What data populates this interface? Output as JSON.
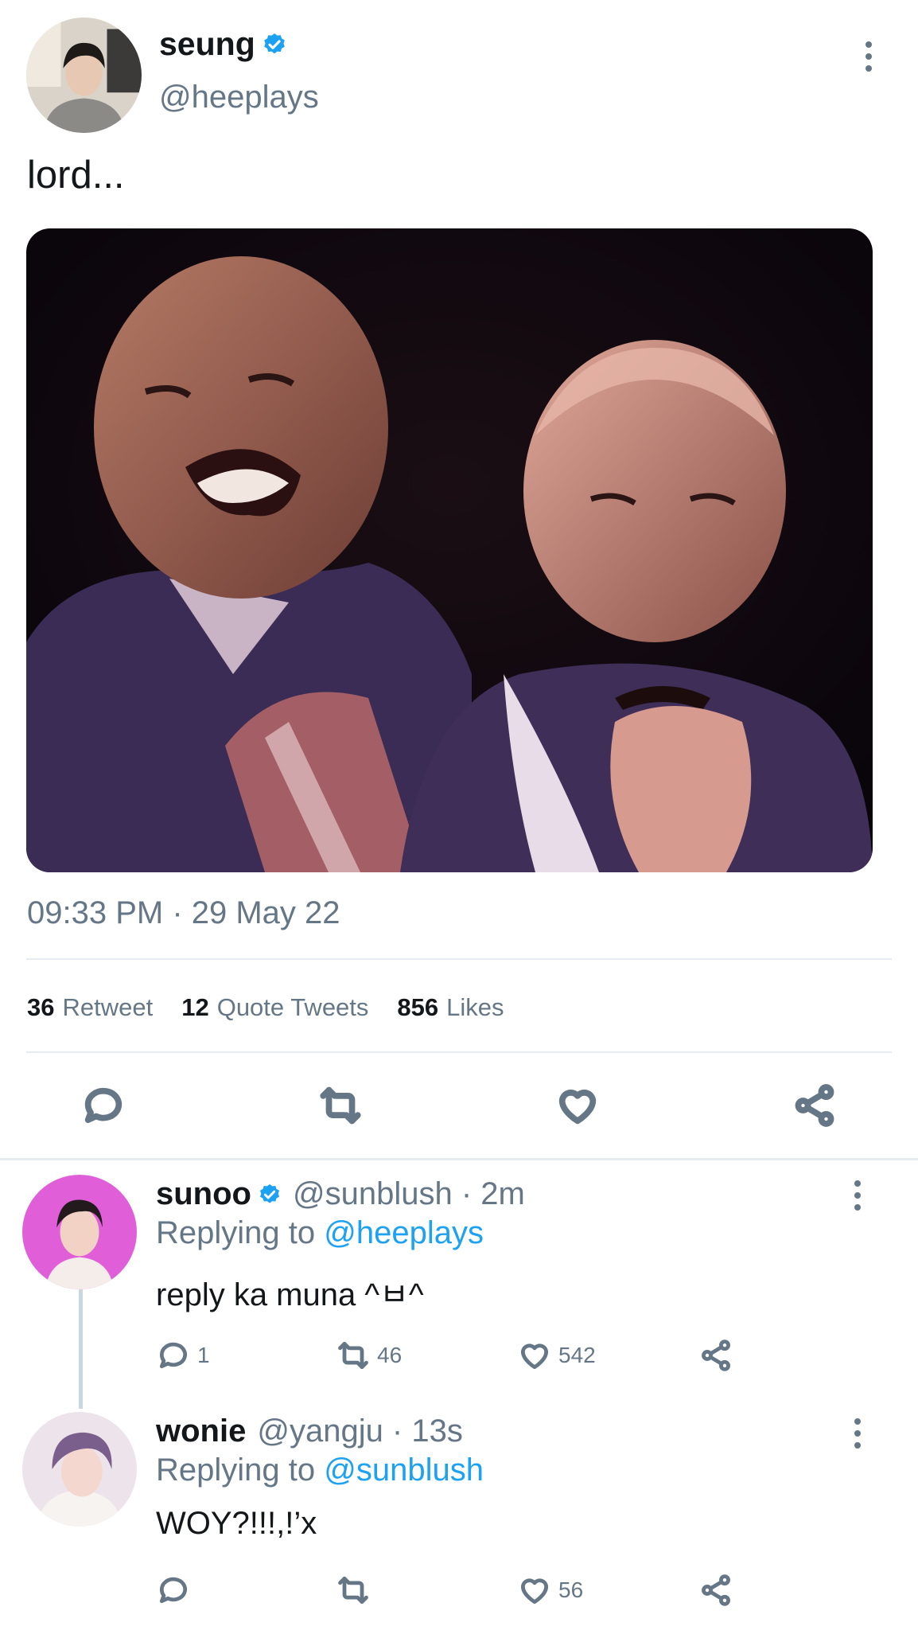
{
  "tweet": {
    "name": "seung",
    "handle": "@heeplays",
    "text": "lord...",
    "timestamp": "09:33 PM · 29 May 22",
    "stats": {
      "retweets_count": "36",
      "retweets_label": "Retweet",
      "quotes_count": "12",
      "quotes_label": "Quote Tweets",
      "likes_count": "856",
      "likes_label": "Likes"
    },
    "media_description": "Meme photo: man laughing beside same man looking worried",
    "actions": [
      "reply-icon",
      "retweet-icon",
      "like-icon",
      "share-icon"
    ]
  },
  "replies": [
    {
      "name": "sunoo",
      "handle": "@sunblush · 2m",
      "replying_prefix": "Replying to",
      "replying_to": "@heeplays",
      "text": "reply ka muna ^ㅂ^",
      "reply_count": "1",
      "retweet_count": "46",
      "like_count": "542"
    },
    {
      "name": "wonie",
      "handle": "@yangju · 13s",
      "replying_prefix": "Replying to",
      "replying_to": "@sunblush",
      "text": "WOY?!!!,!’x",
      "reply_count": "",
      "retweet_count": "",
      "like_count": "56"
    }
  ],
  "colors": {
    "text": "#14171a",
    "muted": "#657786",
    "link": "#1da1f2",
    "divider": "#e6ecf0",
    "verified": "#1da1f2"
  }
}
